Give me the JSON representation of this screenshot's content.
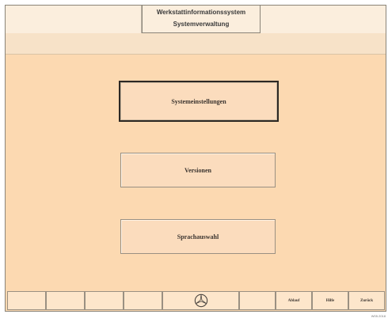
{
  "header": {
    "title_line1": "Werkstattinformationssystem",
    "title_line2": "Systemverwaltung"
  },
  "menu": {
    "items": [
      {
        "label": "Systemeinstellungen",
        "focused": true
      },
      {
        "label": "Versionen",
        "focused": false
      },
      {
        "label": "Sprachauswahl",
        "focused": false
      }
    ]
  },
  "toolbar": {
    "logo_icon": "mercedes-star-icon",
    "ablauf_label": "Ablauf",
    "hilfe_label": "Hilfe",
    "zurueck_label": "Zurück"
  },
  "footer": {
    "image_code": "W05.2018"
  },
  "colors": {
    "background": "#fcd9b1",
    "header": "#fbeedd",
    "button": "#fbdcbd"
  }
}
